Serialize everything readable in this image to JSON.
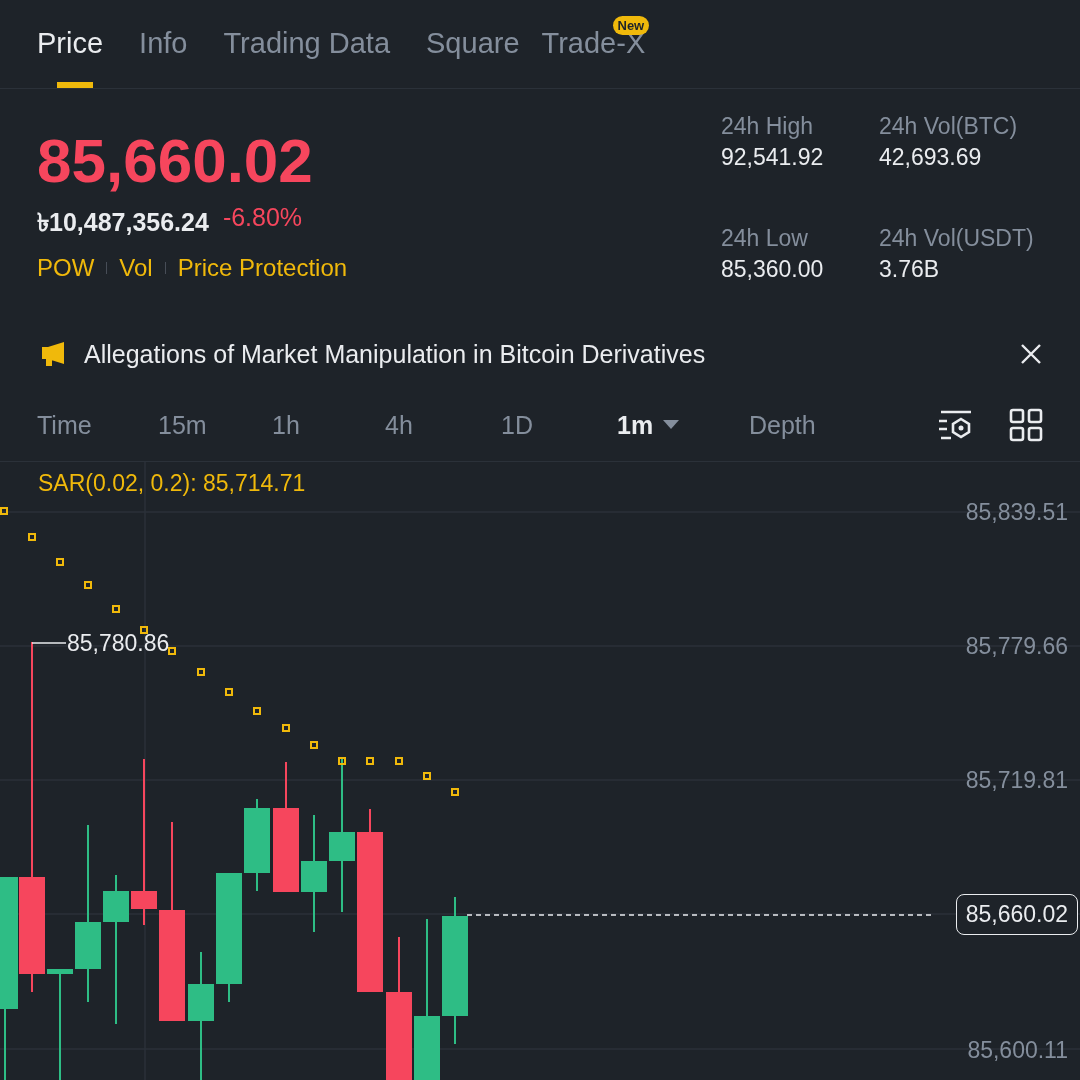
{
  "tabs": [
    {
      "label": "Price",
      "selected": true
    },
    {
      "label": "Info",
      "selected": false
    },
    {
      "label": "Trading Data",
      "selected": false
    },
    {
      "label": "Square",
      "selected": false
    },
    {
      "label": "Trade-X",
      "selected": false,
      "badge": "New"
    }
  ],
  "ticker": {
    "last_price": "85,660.02",
    "fiat_price": "৳10,487,356.24",
    "change": "-6.80%",
    "price_down": true,
    "tags": [
      "POW",
      "Vol",
      "Price Protection"
    ]
  },
  "stats": [
    {
      "label": "24h High",
      "value": "92,541.92"
    },
    {
      "label": "24h Vol(BTC)",
      "value": "42,693.69"
    },
    {
      "label": "24h Low",
      "value": "85,360.00"
    },
    {
      "label": "24h Vol(USDT)",
      "value": "3.76B"
    }
  ],
  "announcement": {
    "text": "Allegations of Market Manipulation in Bitcoin Derivatives"
  },
  "intervals": [
    {
      "label": "Time",
      "selected": false
    },
    {
      "label": "15m",
      "selected": false
    },
    {
      "label": "1h",
      "selected": false
    },
    {
      "label": "4h",
      "selected": false
    },
    {
      "label": "1D",
      "selected": false
    },
    {
      "label": "1m",
      "selected": true,
      "dropdown": true
    },
    {
      "label": "Depth",
      "selected": false
    }
  ],
  "chart": {
    "indicator": "SAR(0.02, 0.2): 85,714.71",
    "price_axis": [
      "85,839.51",
      "85,779.66",
      "85,719.81",
      "85,600.11"
    ],
    "high_marker": "85,780.86",
    "current_price": "85,660.02"
  }
}
